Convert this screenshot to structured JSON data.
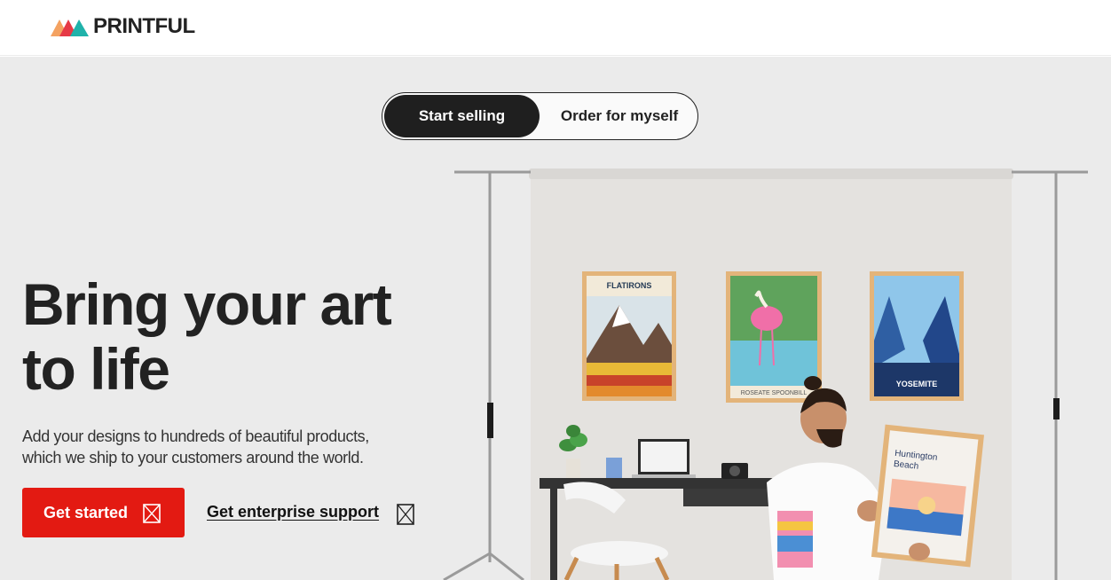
{
  "brand": {
    "name": "PRINTFUL",
    "colors": {
      "orange": "#f4a261",
      "red": "#e63946",
      "teal": "#20b2aa",
      "cta": "#e31a12"
    }
  },
  "toggle": {
    "options": [
      {
        "label": "Start selling",
        "active": true
      },
      {
        "label": "Order for myself",
        "active": false
      }
    ]
  },
  "hero": {
    "headline_line1": "Bring your art",
    "headline_line2": "to life",
    "subtitle_line1": "Add your designs to hundreds of beautiful products,",
    "subtitle_line2": "which we ship to your customers around the world.",
    "cta_label": "Get started",
    "cta_icon": "external-link-icon",
    "link_label": "Get enterprise support",
    "link_icon": "external-link-icon"
  },
  "scene": {
    "poster_left_title": "FLATIRONS",
    "poster_middle_title": "ROSEATE SPOONBILL",
    "poster_right_title": "YOSEMITE",
    "held_poster_title_line1": "Huntington",
    "held_poster_title_line2": "Beach"
  }
}
